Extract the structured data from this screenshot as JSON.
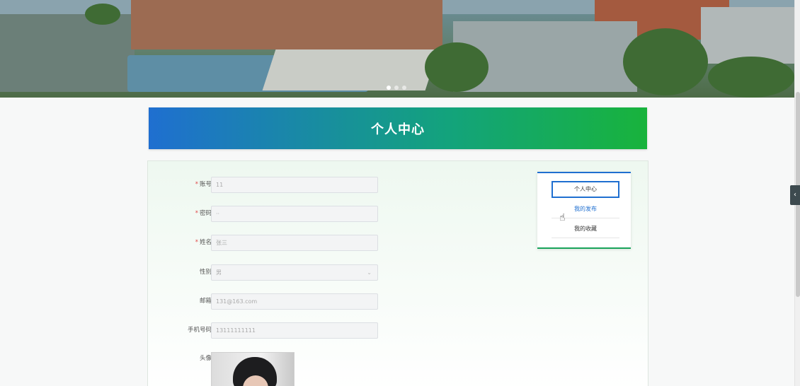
{
  "banner": {
    "slides": 3,
    "active_slide": 1
  },
  "title_bar": {
    "title": "个人中心"
  },
  "form": {
    "fields": [
      {
        "label": "账号",
        "required": true,
        "value": "11"
      },
      {
        "label": "密码",
        "required": true,
        "value": "··"
      },
      {
        "label": "姓名",
        "required": true,
        "value": "张三"
      },
      {
        "label": "性别",
        "required": false,
        "value": "男",
        "type": "select"
      },
      {
        "label": "邮箱",
        "required": false,
        "value": "131@163.com"
      },
      {
        "label": "手机号码",
        "required": false,
        "value": "13111111111"
      },
      {
        "label": "头像",
        "required": false,
        "type": "image"
      }
    ],
    "required_mark": "*"
  },
  "side_menu": {
    "items": [
      {
        "label": "个人中心",
        "active": true
      },
      {
        "label": "我的发布",
        "active": false
      },
      {
        "label": "我的收藏",
        "active": false
      }
    ]
  },
  "side_toggle": {
    "icon": "‹"
  },
  "colors": {
    "accent_blue": "#1f6fd0",
    "accent_green": "#18b33c",
    "required": "#e04a4a"
  }
}
